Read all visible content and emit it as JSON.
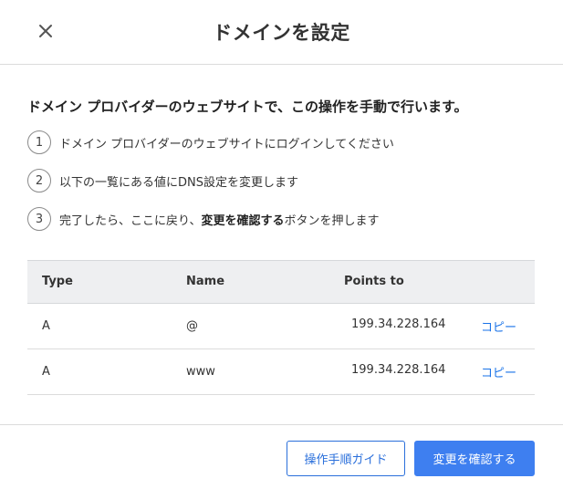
{
  "dialog": {
    "title": "ドメインを設定",
    "intro": "ドメイン プロバイダーのウェブサイトで、この操作を手動で行います。"
  },
  "steps": [
    {
      "num": "1",
      "text": "ドメイン プロバイダーのウェブサイトにログインしてください"
    },
    {
      "num": "2",
      "text": "以下の一覧にある値にDNS設定を変更します"
    },
    {
      "num": "3",
      "text_before": "完了したら、ここに戻り、",
      "text_bold": "変更を確認する",
      "text_after": "ボタンを押します"
    }
  ],
  "table": {
    "headers": {
      "type": "Type",
      "name": "Name",
      "points_to": "Points to"
    },
    "rows": [
      {
        "type": "A",
        "name": "@",
        "points_to": "199.34.228.164",
        "copy": "コピー"
      },
      {
        "type": "A",
        "name": "www",
        "points_to": "199.34.228.164",
        "copy": "コピー"
      }
    ]
  },
  "footer": {
    "guide_label": "操作手順ガイド",
    "confirm_label": "変更を確認する"
  },
  "icons": {
    "close": "close-icon"
  },
  "colors": {
    "accent": "#3e7ff0",
    "link": "#1a73e8",
    "header_bg": "#eeeff1"
  }
}
